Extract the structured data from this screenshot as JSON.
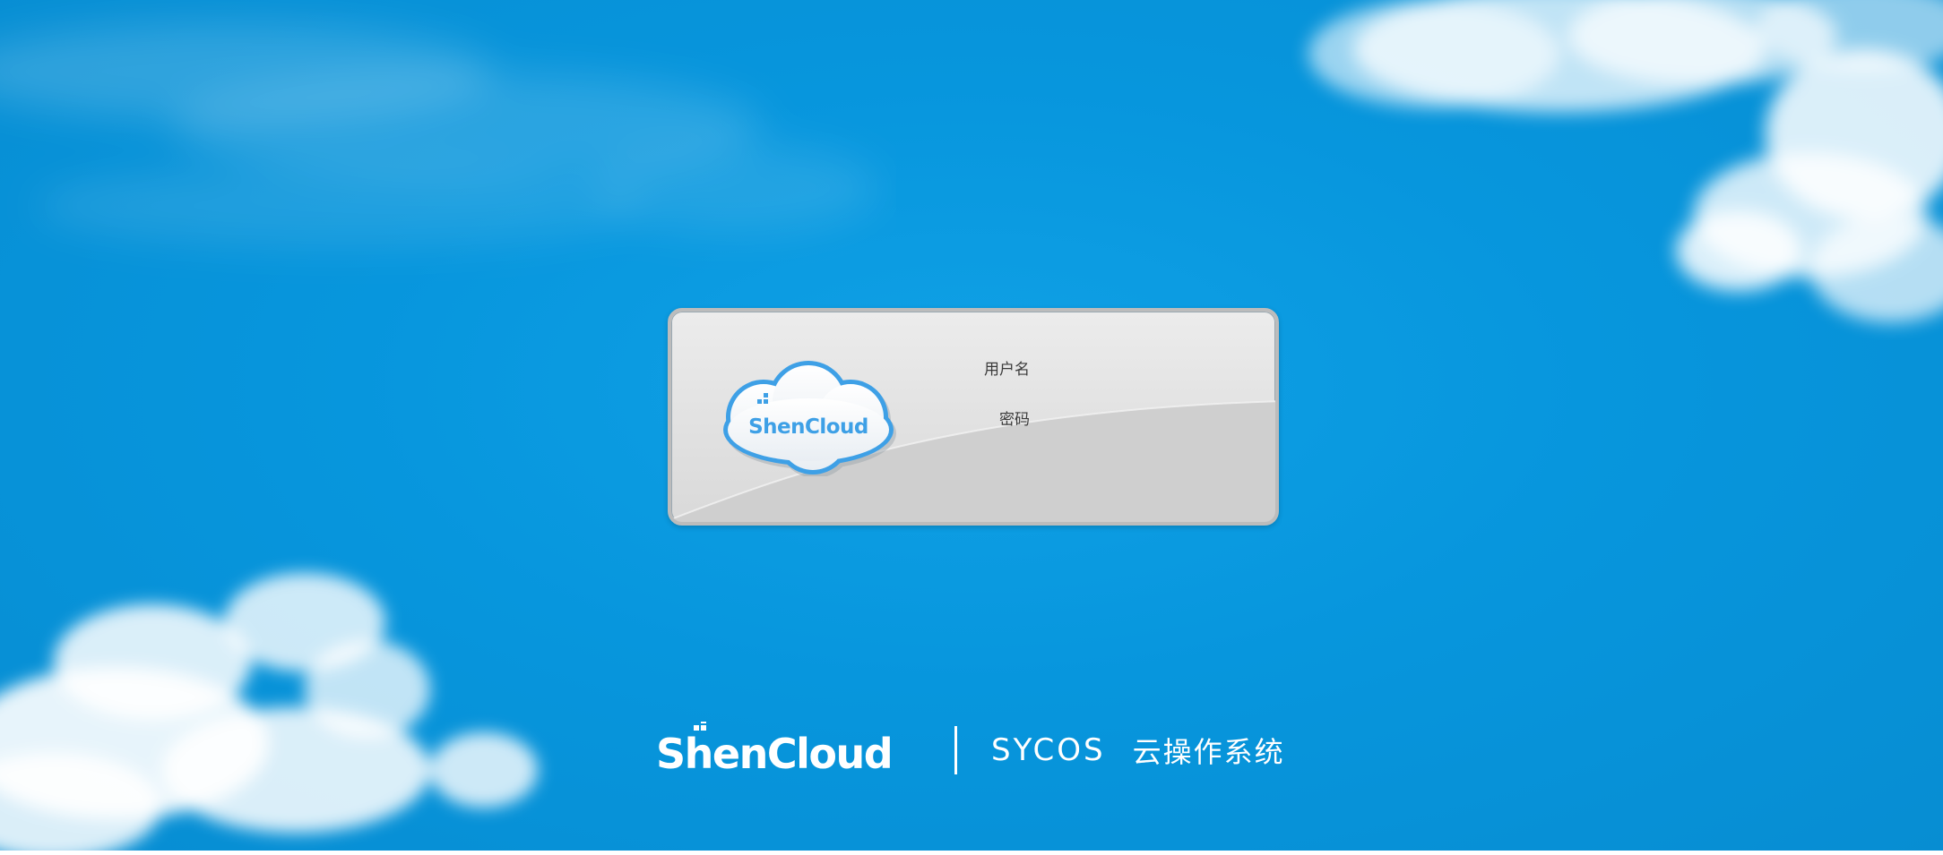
{
  "login": {
    "username_label": "用户名",
    "password_label": "密码",
    "username_value": "",
    "password_value": ""
  },
  "logo": {
    "brand_text": "ShenCloud"
  },
  "footer": {
    "brand_text": "ShenCloud",
    "product": "SYCOS",
    "subtitle": "云操作系统"
  },
  "colors": {
    "background": "#0796dd",
    "logo_blue": "#3ea0e6",
    "panel": "#e6e6e6"
  }
}
